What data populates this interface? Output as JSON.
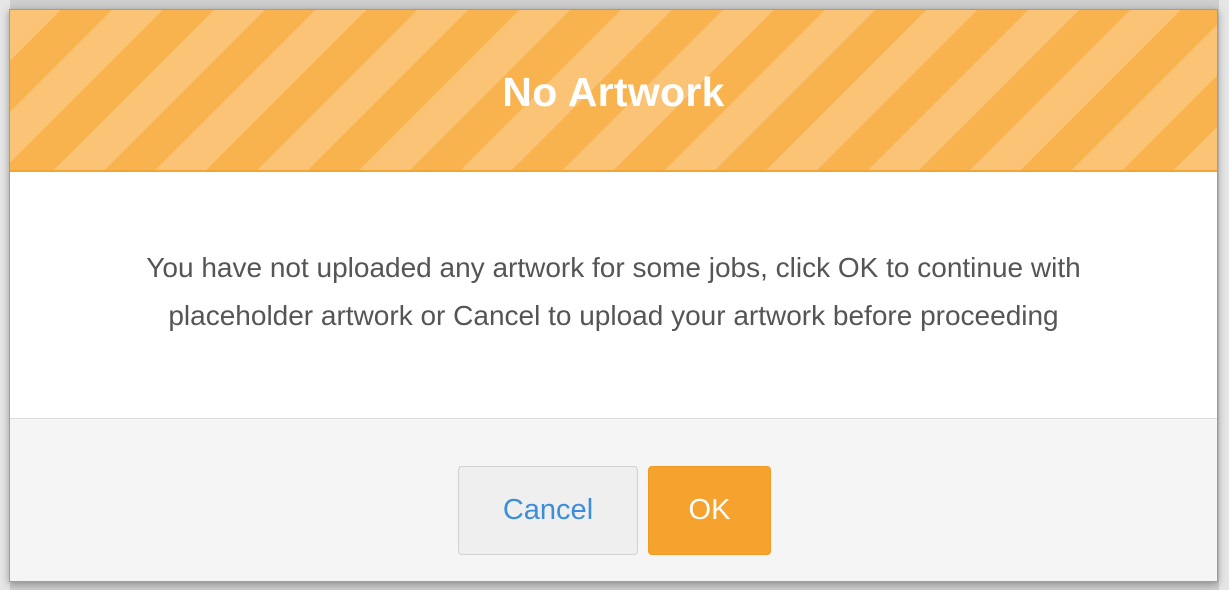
{
  "dialog": {
    "title": "No Artwork",
    "message": "You have not uploaded any artwork for some jobs, click OK to continue with placeholder artwork or Cancel to upload your artwork before proceeding",
    "buttons": {
      "cancel_label": "Cancel",
      "ok_label": "OK"
    }
  },
  "colors": {
    "header_accent": "#f8b24e",
    "ok_button": "#f6a22f",
    "cancel_text": "#3b8edb",
    "message_text": "#555555",
    "footer_background": "#f5f5f5"
  }
}
